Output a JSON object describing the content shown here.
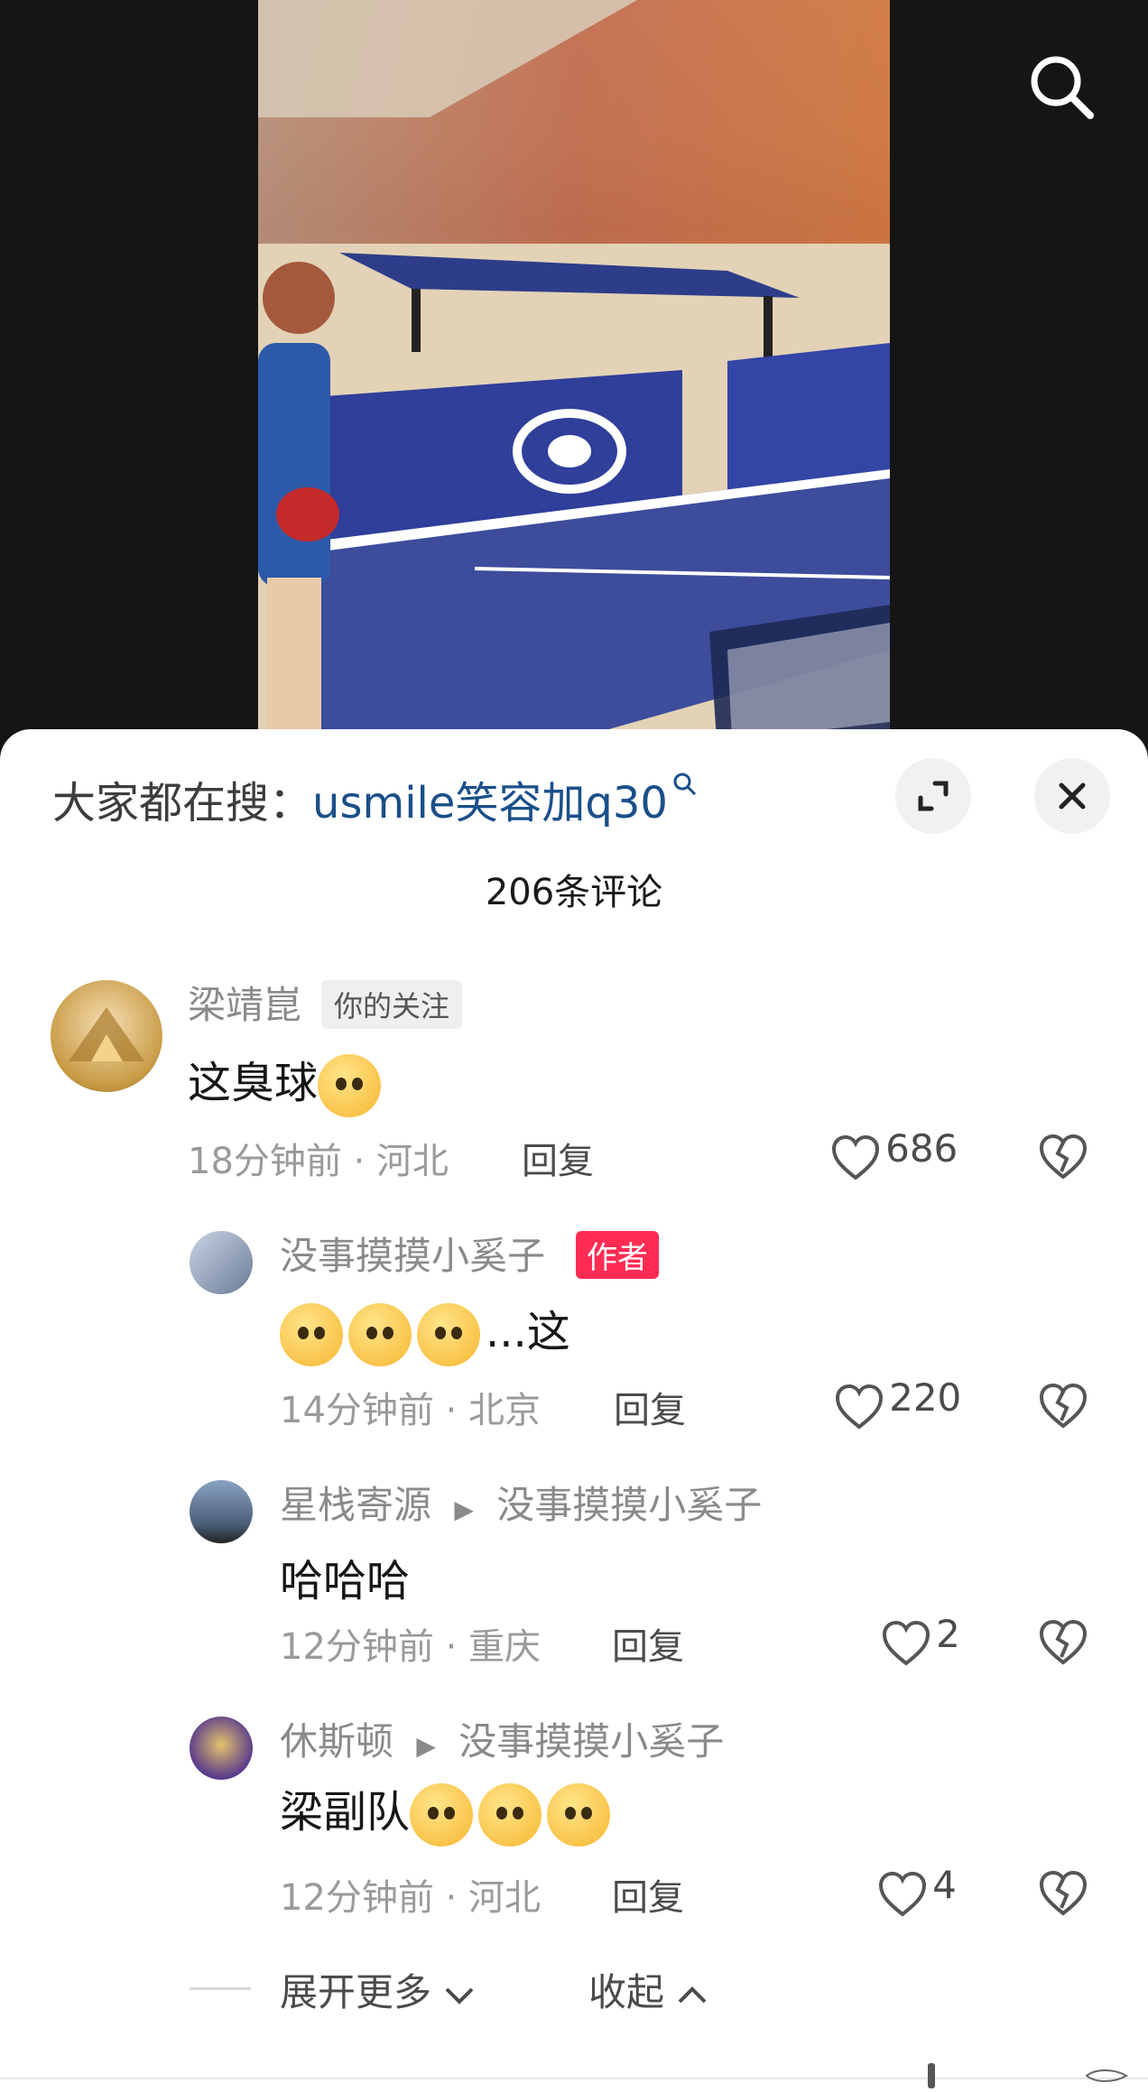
{
  "search_bar": {
    "prefix": "大家都在搜：",
    "query": "usmile笑容加q30"
  },
  "comment_count": "206条评论",
  "comments": [
    {
      "user": "梁靖崑",
      "tag": "你的关注",
      "text": "这臭球",
      "time_loc": "18分钟前 · 河北",
      "reply": "回复",
      "likes": "686"
    },
    {
      "user": "没事摸摸小奚子",
      "tag": "作者",
      "text": "...这",
      "time_loc": "14分钟前 · 北京",
      "reply": "回复",
      "likes": "220"
    },
    {
      "user": "星栈寄源",
      "reply_to": "没事摸摸小奚子",
      "text": "哈哈哈",
      "time_loc": "12分钟前 · 重庆",
      "reply": "回复",
      "likes": "2"
    },
    {
      "user": "休斯顿",
      "reply_to": "没事摸摸小奚子",
      "text": "梁副队",
      "time_loc": "12分钟前 · 河北",
      "reply": "回复",
      "likes": "4"
    }
  ],
  "expand_more": "展开更多",
  "collapse": "收起",
  "colors": {
    "query_blue": "#1a4f8a",
    "author_badge": "#fe2c55",
    "table_blue": "#2f3f9a"
  },
  "icons": [
    "search-icon",
    "expand-icon",
    "close-icon",
    "heart-icon",
    "broken-heart-icon",
    "chevron-down-icon",
    "chevron-up-icon",
    "reply-arrow-icon"
  ]
}
